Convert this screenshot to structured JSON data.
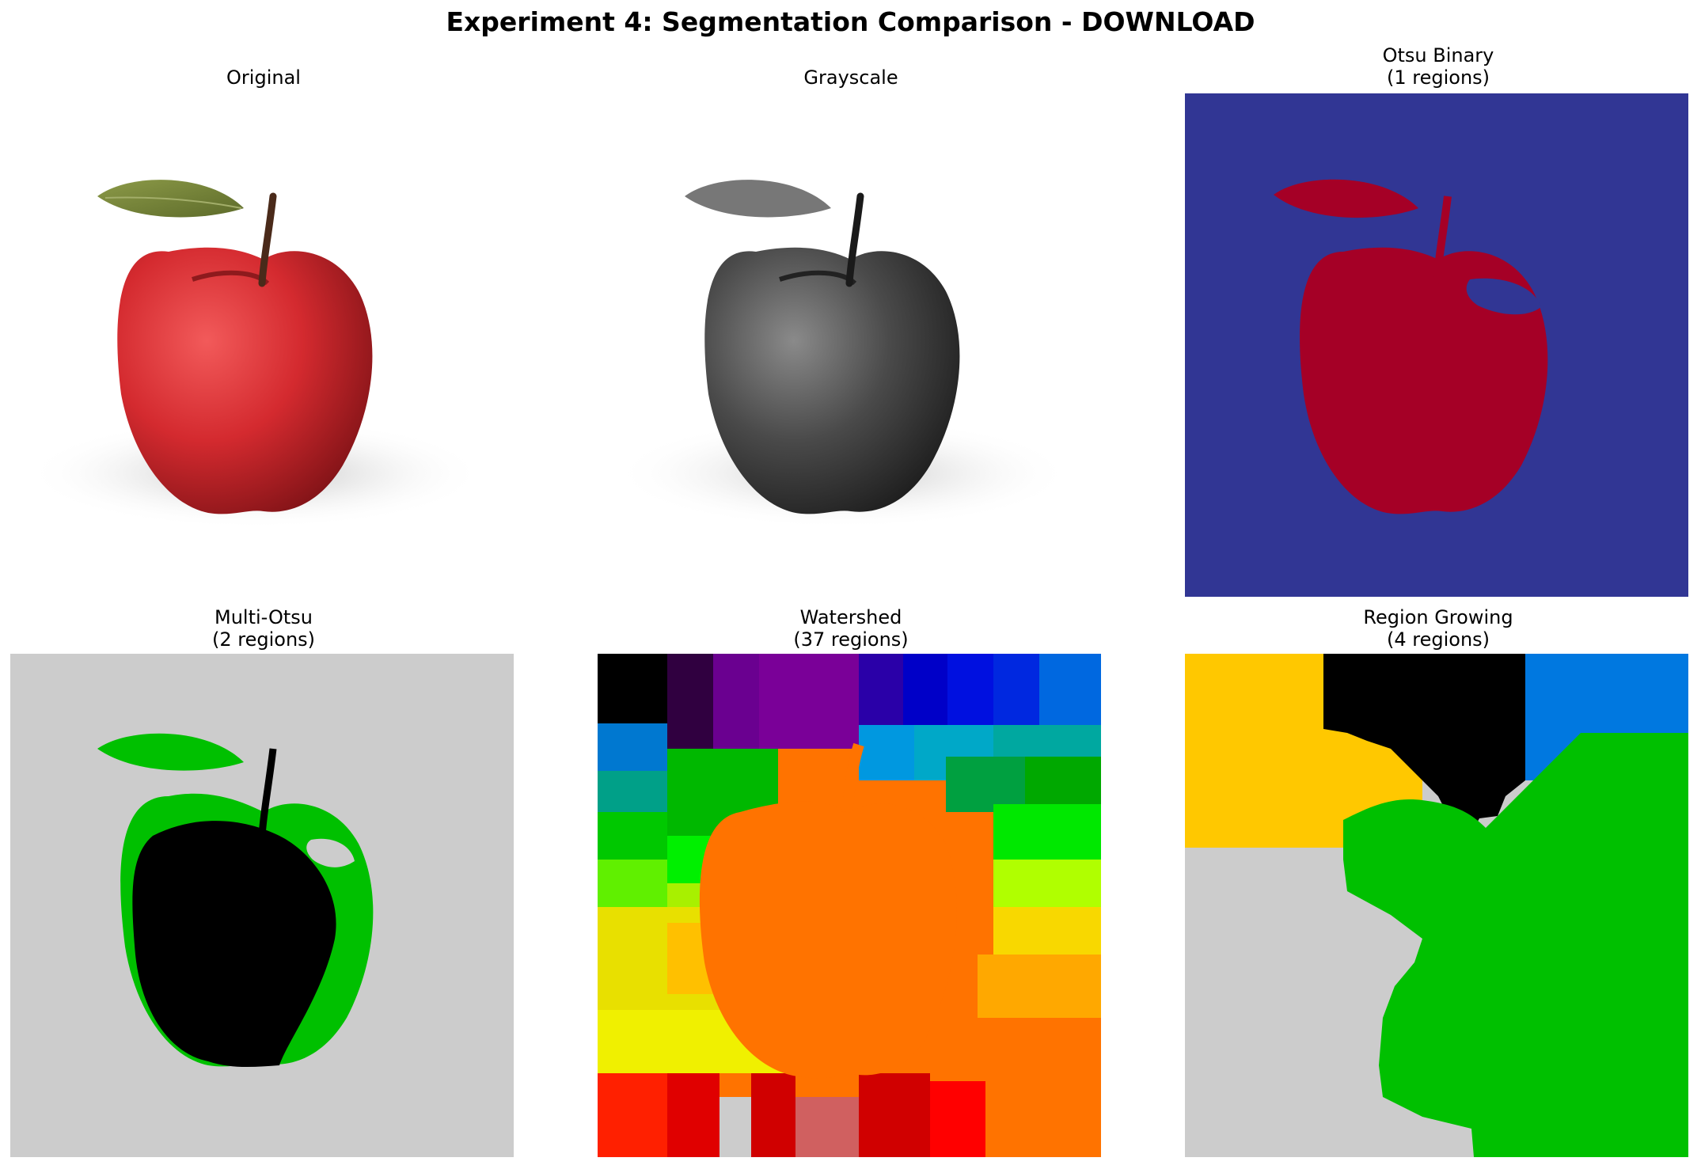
{
  "figure": {
    "title": "Experiment 4: Segmentation Comparison - DOWNLOAD"
  },
  "panels": [
    {
      "id": "original",
      "title": "Original",
      "subtitle": ""
    },
    {
      "id": "grayscale",
      "title": "Grayscale",
      "subtitle": ""
    },
    {
      "id": "otsu",
      "title": "Otsu Binary",
      "subtitle": "(1 regions)"
    },
    {
      "id": "multi_otsu",
      "title": "Multi-Otsu",
      "subtitle": "(2 regions)"
    },
    {
      "id": "watershed",
      "title": "Watershed",
      "subtitle": "(37 regions)"
    },
    {
      "id": "region_growing",
      "title": "Region Growing",
      "subtitle": "(4 regions)"
    }
  ],
  "colors": {
    "apple_red": "#d42a2f",
    "leaf_green": "#7c8a3a",
    "otsu_background": "#313694",
    "otsu_foreground": "#a50026",
    "multi_otsu_background": "#cccccc",
    "multi_otsu_green": "#00c000",
    "watershed_apple": "#ff7300",
    "region_yellow": "#ffc800",
    "region_blue": "#0078e0",
    "region_green": "#00c000",
    "region_gray": "#cccccc"
  }
}
